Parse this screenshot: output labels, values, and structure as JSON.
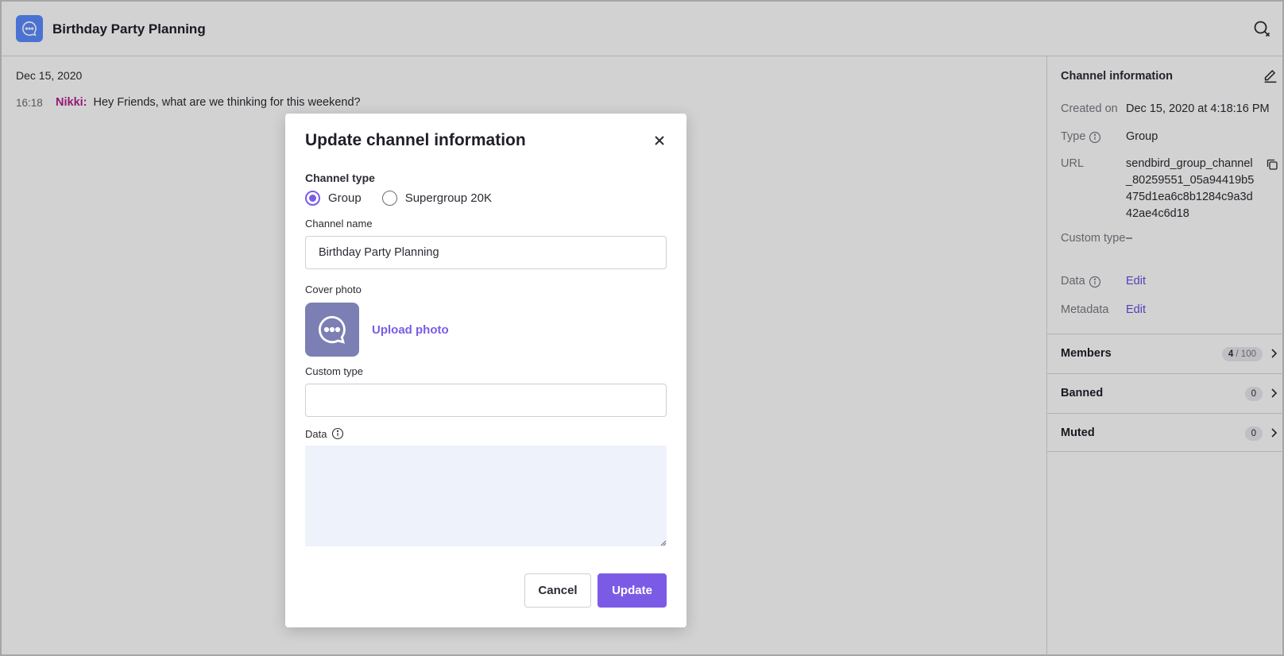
{
  "header": {
    "title": "Birthday Party Planning",
    "avatar_icon": "chat-bubble-icon",
    "search_icon": "search-close-icon",
    "avatar_color": "#5a8bff"
  },
  "chat": {
    "date": "Dec 15, 2020",
    "messages": [
      {
        "time": "16:18",
        "author": "Nikki:",
        "text": "Hey Friends, what are we thinking for this weekend?"
      }
    ]
  },
  "panel": {
    "title": "Channel information",
    "edit_icon": "pencil-icon",
    "rows": {
      "created_label": "Created on",
      "created_value": "Dec 15, 2020 at 4:18:16 PM",
      "type_label": "Type",
      "type_value": "Group",
      "url_label": "URL",
      "url_value": "sendbird_group_channel_80259551_05a94419b5475d1ea6c8b1284c9a3d42ae4c6d18",
      "custom_type_label": "Custom type",
      "custom_type_value": "–",
      "data_label": "Data",
      "data_value": "Edit",
      "metadata_label": "Metadata",
      "metadata_value": "Edit"
    },
    "sections": [
      {
        "label": "Members",
        "count": "4",
        "total": " / 100"
      },
      {
        "label": "Banned",
        "count": "0"
      },
      {
        "label": "Muted",
        "count": "0"
      }
    ]
  },
  "modal": {
    "title": "Update channel information",
    "channel_type_label": "Channel type",
    "options": [
      {
        "label": "Group",
        "checked": true
      },
      {
        "label": "Supergroup 20K",
        "checked": false
      }
    ],
    "channel_name_label": "Channel name",
    "channel_name_value": "Birthday Party Planning",
    "cover_photo_label": "Cover photo",
    "upload_label": "Upload photo",
    "custom_type_label": "Custom type",
    "custom_type_value": "",
    "data_label": "Data",
    "data_value": "",
    "cancel_label": "Cancel",
    "update_label": "Update"
  },
  "colors": {
    "accent": "#7b5be6",
    "author": "#b3208b",
    "cover_bg": "#7b7fb3"
  }
}
